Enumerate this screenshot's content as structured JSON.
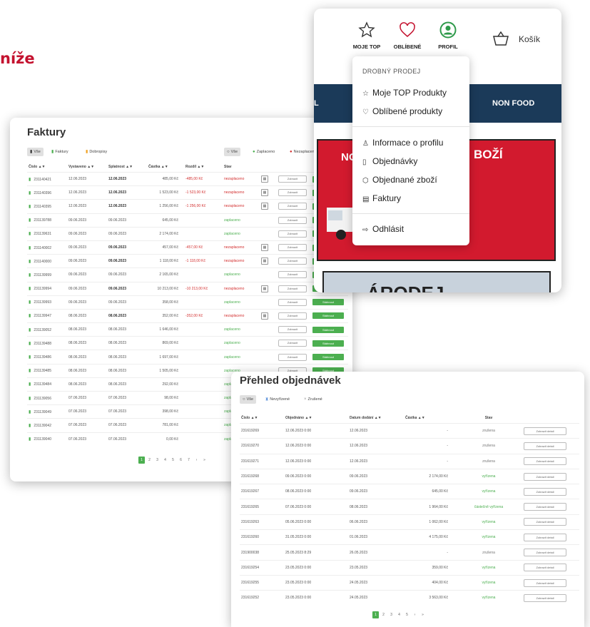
{
  "heading": "níže",
  "invoices": {
    "title": "Faktury",
    "filters_left": [
      {
        "icon": "document-icon",
        "label": "Vše",
        "color": "#333"
      },
      {
        "icon": "document-icon",
        "label": "Faktury",
        "color": "#4caf50"
      },
      {
        "icon": "document-icon",
        "label": "Dobropisy",
        "color": "#f0a020"
      }
    ],
    "filters_right": [
      {
        "icon": "circle-icon",
        "label": "Vše"
      },
      {
        "icon": "check-icon",
        "label": "Zaplaceno"
      },
      {
        "icon": "cross-icon",
        "label": "Nezaplaceno"
      }
    ],
    "columns": [
      "Číslo ▲▼",
      "Vystaveno ▲▼",
      "Splatnost ▲▼",
      "Částka ▲▼",
      "Rozdíl ▲▼",
      "Stav"
    ],
    "show_label": "Zobrazit",
    "download_label": "Stáhnout",
    "rows": [
      {
        "num": "231140421",
        "issued": "12.06.2023",
        "due": "12.06.2023",
        "amount": "485,00 Kč",
        "diff": "-485,00 Kč",
        "status": "nezaplaceno"
      },
      {
        "num": "231140396",
        "issued": "12.06.2023",
        "due": "12.06.2023",
        "amount": "1 523,00 Kč",
        "diff": "-1 523,00 Kč",
        "status": "nezaplaceno"
      },
      {
        "num": "231140395",
        "issued": "12.06.2023",
        "due": "12.06.2023",
        "amount": "1 256,00 Kč",
        "diff": "-1 256,00 Kč",
        "status": "nezaplaceno"
      },
      {
        "num": "231139788",
        "issued": "09.06.2023",
        "due": "09.06.2023",
        "amount": "645,00 Kč",
        "diff": "",
        "status": "zaplaceno"
      },
      {
        "num": "231139631",
        "issued": "09.06.2023",
        "due": "09.06.2023",
        "amount": "2 174,00 Kč",
        "diff": "",
        "status": "zaplaceno"
      },
      {
        "num": "231140002",
        "issued": "09.06.2023",
        "due": "09.06.2023",
        "amount": "457,00 Kč",
        "diff": "-457,00 Kč",
        "status": "nezaplaceno"
      },
      {
        "num": "231140000",
        "issued": "09.06.2023",
        "due": "09.06.2023",
        "amount": "1 118,00 Kč",
        "diff": "-1 118,00 Kč",
        "status": "nezaplaceno"
      },
      {
        "num": "231139999",
        "issued": "09.06.2023",
        "due": "09.06.2023",
        "amount": "2 165,00 Kč",
        "diff": "",
        "status": "zaplaceno"
      },
      {
        "num": "231139994",
        "issued": "09.06.2023",
        "due": "09.06.2023",
        "amount": "10 213,00 Kč",
        "diff": "-10 213,00 Kč",
        "status": "nezaplaceno"
      },
      {
        "num": "231139993",
        "issued": "09.06.2023",
        "due": "09.06.2023",
        "amount": "358,00 Kč",
        "diff": "",
        "status": "zaplaceno"
      },
      {
        "num": "231139947",
        "issued": "08.06.2023",
        "due": "08.06.2023",
        "amount": "352,00 Kč",
        "diff": "-352,00 Kč",
        "status": "nezaplaceno"
      },
      {
        "num": "231139052",
        "issued": "08.06.2023",
        "due": "08.06.2023",
        "amount": "1 646,00 Kč",
        "diff": "",
        "status": "zaplaceno"
      },
      {
        "num": "231139488",
        "issued": "08.06.2023",
        "due": "08.06.2023",
        "amount": "869,00 Kč",
        "diff": "",
        "status": "zaplaceno"
      },
      {
        "num": "231139486",
        "issued": "08.06.2023",
        "due": "08.06.2023",
        "amount": "1 697,00 Kč",
        "diff": "",
        "status": "zaplaceno"
      },
      {
        "num": "231139485",
        "issued": "08.06.2023",
        "due": "08.06.2023",
        "amount": "1 505,00 Kč",
        "diff": "",
        "status": "zaplaceno"
      },
      {
        "num": "231139484",
        "issued": "08.06.2023",
        "due": "08.06.2023",
        "amount": "292,00 Kč",
        "diff": "",
        "status": "zaplaceno"
      },
      {
        "num": "231139056",
        "issued": "07.06.2023",
        "due": "07.06.2023",
        "amount": "98,00 Kč",
        "diff": "",
        "status": "zaplaceno"
      },
      {
        "num": "231139049",
        "issued": "07.06.2023",
        "due": "07.06.2023",
        "amount": "398,00 Kč",
        "diff": "",
        "status": "zaplaceno"
      },
      {
        "num": "231139042",
        "issued": "07.06.2023",
        "due": "07.06.2023",
        "amount": "781,00 Kč",
        "diff": "",
        "status": "zaplaceno"
      },
      {
        "num": "231139040",
        "issued": "07.06.2023",
        "due": "07.06.2023",
        "amount": "0,00 Kč",
        "diff": "",
        "status": "zaplaceno"
      }
    ],
    "pages": [
      "1",
      "2",
      "3",
      "4",
      "5",
      "6",
      "7",
      "›",
      "»"
    ]
  },
  "orders": {
    "title": "Přehled objednávek",
    "filters": [
      {
        "icon": "circle-icon",
        "label": "Vše"
      },
      {
        "icon": "hourglass-icon",
        "label": "Nevyřízené"
      },
      {
        "icon": "cross-icon",
        "label": "Zrušené"
      }
    ],
    "columns": [
      "Číslo ▲▼",
      "Objednáno ▲▼",
      "Datum dodání ▲▼",
      "Částka ▲▼",
      "Stav"
    ],
    "show_label": "Zobrazit detail",
    "rows": [
      {
        "num": "231619269",
        "ordered": "12.06.2023 0:00",
        "delivery": "12.06.2023",
        "amount": "-",
        "status": "zrušena",
        "kind": "cancel"
      },
      {
        "num": "231619270",
        "ordered": "12.06.2023 0:00",
        "delivery": "12.06.2023",
        "amount": "-",
        "status": "zrušena",
        "kind": "cancel"
      },
      {
        "num": "231619271",
        "ordered": "12.06.2023 0:00",
        "delivery": "12.06.2023",
        "amount": "-",
        "status": "zrušena",
        "kind": "cancel"
      },
      {
        "num": "231619268",
        "ordered": "09.06.2023 0:00",
        "delivery": "09.06.2023",
        "amount": "2 174,00 Kč",
        "status": "vyřízena",
        "kind": "ok"
      },
      {
        "num": "231619267",
        "ordered": "08.06.2023 0:00",
        "delivery": "09.06.2023",
        "amount": "645,00 Kč",
        "status": "vyřízena",
        "kind": "ok"
      },
      {
        "num": "231619265",
        "ordered": "07.06.2023 0:00",
        "delivery": "08.06.2023",
        "amount": "1 964,00 Kč",
        "status": "částečně vyřízena",
        "kind": "ok"
      },
      {
        "num": "231619263",
        "ordered": "05.06.2023 0:00",
        "delivery": "06.06.2023",
        "amount": "1 062,00 Kč",
        "status": "vyřízena",
        "kind": "ok"
      },
      {
        "num": "231619260",
        "ordered": "31.05.2023 0:00",
        "delivery": "01.06.2023",
        "amount": "4 175,00 Kč",
        "status": "vyřízena",
        "kind": "ok"
      },
      {
        "num": "231900038",
        "ordered": "25.05.2023 8:29",
        "delivery": "26.05.2023",
        "amount": "-",
        "status": "zrušena",
        "kind": "cancel"
      },
      {
        "num": "231619254",
        "ordered": "23.05.2023 0:00",
        "delivery": "23.05.2023",
        "amount": "359,00 Kč",
        "status": "vyřízena",
        "kind": "ok"
      },
      {
        "num": "231619255",
        "ordered": "23.05.2023 0:00",
        "delivery": "24.05.2023",
        "amount": "404,00 Kč",
        "status": "vyřízena",
        "kind": "ok"
      },
      {
        "num": "231619252",
        "ordered": "23.05.2023 0:00",
        "delivery": "24.05.2023",
        "amount": "3 563,00 Kč",
        "status": "vyřízena",
        "kind": "ok"
      }
    ],
    "pages": [
      "1",
      "2",
      "3",
      "4",
      "5",
      "›",
      "»"
    ]
  },
  "nav": {
    "icons": [
      {
        "icon": "star-icon",
        "label": "MOJE TOP"
      },
      {
        "icon": "heart-icon",
        "label": "OBLÍBENÉ"
      },
      {
        "icon": "profile-icon",
        "label": "PROFIL"
      }
    ],
    "basket": {
      "icon": "basket-icon",
      "label": "Košík"
    },
    "bar_left": "L",
    "bar_right": "NON FOOD",
    "promo_left": "NO",
    "promo_right": "BOŽÍ",
    "promo2_text": "ÁRODEJ",
    "dropdown": {
      "header": "DROBNÝ PRODEJ",
      "group1": [
        {
          "icon": "star-icon",
          "label": "Moje TOP Produkty"
        },
        {
          "icon": "heart-icon",
          "label": "Oblíbené produkty"
        }
      ],
      "group2": [
        {
          "icon": "user-icon",
          "label": "Informace o profilu"
        },
        {
          "icon": "clipboard-icon",
          "label": "Objednávky"
        },
        {
          "icon": "box-icon",
          "label": "Objednané zboží"
        },
        {
          "icon": "invoice-icon",
          "label": "Faktury"
        }
      ],
      "logout": {
        "icon": "logout-icon",
        "label": "Odhlásit"
      }
    }
  },
  "colors": {
    "brand_red": "#c4122f",
    "green": "#4caf50",
    "navy": "#1b3a59",
    "promo_red": "#d21a2e"
  }
}
